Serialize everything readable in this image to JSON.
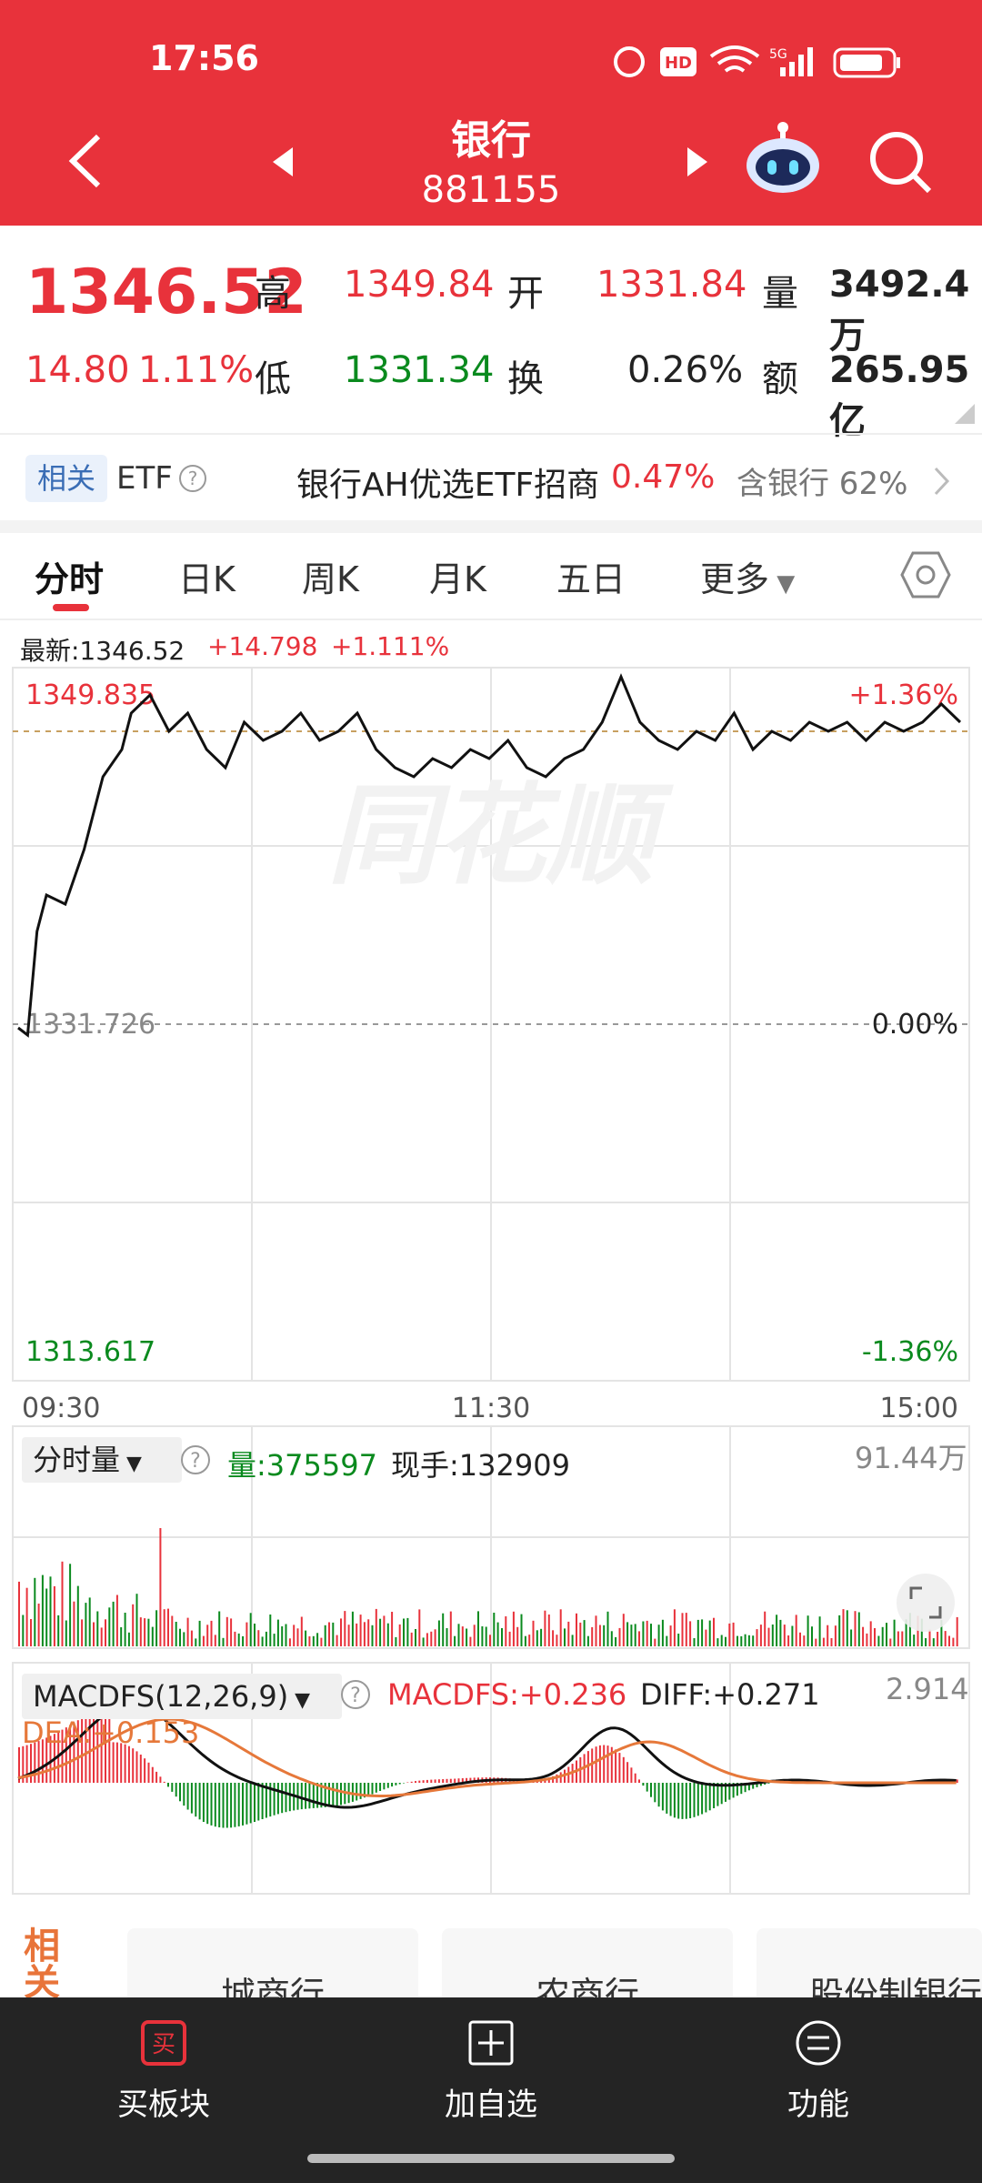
{
  "status": {
    "time": "17:56"
  },
  "header": {
    "title": "银行",
    "code": "881155"
  },
  "quote": {
    "price": "1346.52",
    "change": "14.80",
    "change_pct": "1.11%",
    "high_label": "高",
    "high": "1349.84",
    "open_label": "开",
    "open": "1331.84",
    "volume_label": "量",
    "volume": "3492.4万",
    "low_label": "低",
    "low": "1331.34",
    "turnover_label": "换",
    "turnover": "0.26%",
    "amount_label": "额",
    "amount": "265.95亿"
  },
  "etf": {
    "badge": "相关",
    "label": "ETF",
    "name": "银行AH优选ETF招商",
    "pct": "0.47%",
    "contains": "含银行 62%"
  },
  "tabs": [
    "分时",
    "日K",
    "周K",
    "月K",
    "五日",
    "更多"
  ],
  "intraday": {
    "latest": "最新:1346.52",
    "change": "+14.798",
    "change_pct": "+1.111%",
    "top_price": "1349.835",
    "top_pct": "+1.36%",
    "mid_price": "1331.726",
    "mid_pct": "0.00%",
    "bottom_price": "1313.617",
    "bottom_pct": "-1.36%",
    "times": [
      "09:30",
      "11:30",
      "15:00"
    ]
  },
  "volume_panel": {
    "selector": "分时量",
    "volume": "量:375597",
    "current": "现手:132909",
    "max": "91.44万"
  },
  "macd_panel": {
    "selector": "MACDFS(12,26,9)",
    "macdfs": "MACDFS:+0.236",
    "diff": "DIFF:+0.271",
    "dea": "DEA:+0.153",
    "max": "2.914"
  },
  "related": {
    "badge": "相关",
    "items": [
      "城商行",
      "农商行",
      "股份制银行"
    ]
  },
  "bottom_nav": [
    {
      "icon": "buy-icon",
      "label": "买板块"
    },
    {
      "icon": "plus-box-icon",
      "label": "加自选"
    },
    {
      "icon": "menu-circle-icon",
      "label": "功能"
    }
  ],
  "watermark": "同花顺",
  "colors": {
    "header": "#e8323b",
    "up": "#e8323b",
    "down": "#0a8a1e",
    "price_line": "#111111",
    "dea_line": "#e6783a"
  }
}
